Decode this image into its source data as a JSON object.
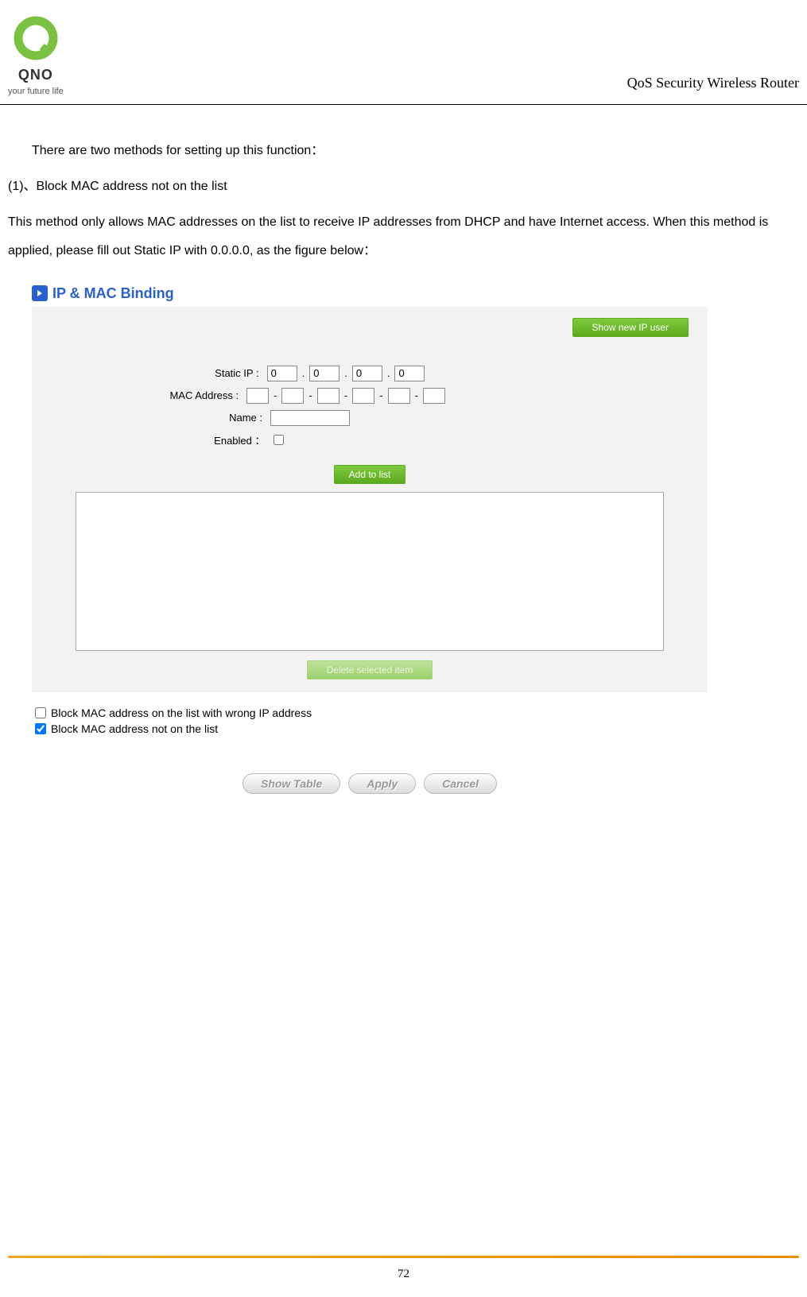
{
  "header": {
    "logo_text": "QNO",
    "logo_tagline": "your future life",
    "doc_title": "QoS Security Wireless Router"
  },
  "content": {
    "intro": "There are two methods for setting up this function：",
    "method_title": "(1)、Block MAC address not on the list",
    "method_desc": "This method only allows MAC addresses on the list to receive IP addresses from DHCP and have Internet access. When this method is applied, please fill out Static IP with 0.0.0.0, as the figure below："
  },
  "panel": {
    "title": "IP & MAC Binding",
    "show_new_btn": "Show new IP user",
    "static_ip_label": "Static IP :",
    "static_ip": [
      "0",
      "0",
      "0",
      "0"
    ],
    "mac_label": "MAC Address :",
    "mac": [
      "",
      "",
      "",
      "",
      "",
      ""
    ],
    "name_label": "Name :",
    "name_value": "",
    "enabled_label": "Enabled ：",
    "enabled_checked": false,
    "add_btn": "Add to list",
    "delete_btn": "Delete selected item",
    "cb1_label": "Block MAC address on the list with wrong IP address",
    "cb1_checked": false,
    "cb2_label": "Block MAC address not on the list",
    "cb2_checked": true,
    "btn_show": "Show Table",
    "btn_apply": "Apply",
    "btn_cancel": "Cancel"
  },
  "footer": {
    "page_num": "72"
  }
}
